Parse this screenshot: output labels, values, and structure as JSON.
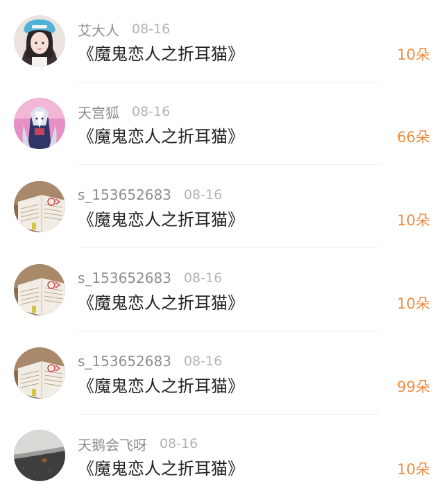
{
  "gifts": [
    {
      "username": "艾大人",
      "date": "08-16",
      "title": "《魔鬼恋人之折耳猫》",
      "amount": "10朵",
      "avatar_icon": "girl-avatar-icon"
    },
    {
      "username": "天宫狐",
      "date": "08-16",
      "title": "《魔鬼恋人之折耳猫》",
      "amount": "66朵",
      "avatar_icon": "anime-avatar-icon"
    },
    {
      "username": "s_153652683",
      "date": "08-16",
      "title": "《魔鬼恋人之折耳猫》",
      "amount": "10朵",
      "avatar_icon": "book-avatar-icon"
    },
    {
      "username": "s_153652683",
      "date": "08-16",
      "title": "《魔鬼恋人之折耳猫》",
      "amount": "10朵",
      "avatar_icon": "book-avatar-icon"
    },
    {
      "username": "s_153652683",
      "date": "08-16",
      "title": "《魔鬼恋人之折耳猫》",
      "amount": "99朵",
      "avatar_icon": "book-avatar-icon"
    },
    {
      "username": "天鹅会飞呀",
      "date": "08-16",
      "title": "《魔鬼恋人之折耳猫》",
      "amount": "10朵",
      "avatar_icon": "ground-avatar-icon"
    }
  ],
  "colors": {
    "accent": "#ef8a3c",
    "username": "#8d8d8d",
    "date": "#b3b3b3",
    "title": "#222222"
  }
}
